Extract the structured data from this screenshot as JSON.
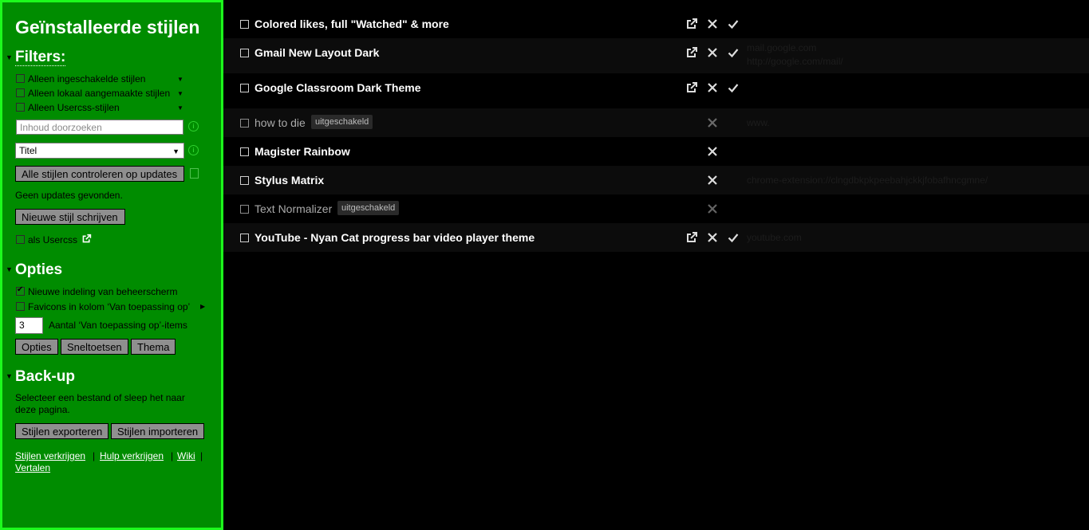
{
  "sidebar": {
    "title": "Geïnstalleerde stijlen",
    "filters": {
      "heading": "Filters:",
      "items": [
        {
          "label": "Alleen ingeschakelde stijlen",
          "checked": false
        },
        {
          "label": "Alleen lokaal aangemaakte stijlen",
          "checked": false
        },
        {
          "label": "Alleen Usercss-stijlen",
          "checked": false
        }
      ],
      "search_placeholder": "Inhoud doorzoeken",
      "sort_value": "Titel"
    },
    "check_updates_label": "Alle stijlen controleren op updates",
    "update_status": "Geen updates gevonden.",
    "new_style_label": "Nieuwe stijl schrijven",
    "as_usercss_label": "als Usercss",
    "options": {
      "heading": "Opties",
      "new_layout_label": "Nieuwe indeling van beheerscherm",
      "new_layout_checked": true,
      "favicons_label": "Favicons in kolom ‘Van toepassing op’",
      "favicons_checked": false,
      "applies_count_value": "3",
      "applies_count_label": "Aantal ‘Van toepassing op’-items",
      "buttons": {
        "options": "Opties",
        "shortcuts": "Sneltoetsen",
        "theme": "Thema"
      }
    },
    "backup": {
      "heading": "Back-up",
      "description_line1": "Selecteer een bestand of sleep het naar",
      "description_line2": "deze pagina.",
      "export_label": "Stijlen exporteren",
      "import_label": "Stijlen importeren"
    },
    "links": {
      "get_styles": "Stijlen verkrijgen",
      "get_help": "Hulp verkrijgen",
      "wiki": "Wiki",
      "translate": "Vertalen",
      "separator": "|"
    }
  },
  "styles": [
    {
      "name": "Colored likes, full \"Watched\" & more",
      "enabled": true,
      "external": true,
      "badge": "",
      "applies": []
    },
    {
      "name": "Gmail New Layout Dark",
      "enabled": true,
      "external": true,
      "badge": "",
      "applies": [
        "mail.google.com",
        "http://google.com/mail/"
      ]
    },
    {
      "name": "Google Classroom Dark Theme",
      "enabled": true,
      "external": true,
      "badge": "",
      "applies": []
    },
    {
      "name": "how to die",
      "enabled": false,
      "external": false,
      "badge": "uitgeschakeld",
      "applies": [
        "www."
      ]
    },
    {
      "name": "Magister Rainbow",
      "enabled": true,
      "external": false,
      "badge": "",
      "applies": []
    },
    {
      "name": "Stylus Matrix",
      "enabled": true,
      "external": false,
      "badge": "",
      "applies": [
        "chrome-extension://clngdbkpkpeebahjckkjfobafhncgmne/"
      ]
    },
    {
      "name": "Text Normalizer",
      "enabled": false,
      "external": false,
      "badge": "uitgeschakeld",
      "applies": []
    },
    {
      "name": "YouTube - Nyan Cat progress bar video player theme",
      "enabled": true,
      "external": true,
      "badge": "",
      "applies": [
        "youtube.com"
      ]
    }
  ],
  "colors": {
    "sidebar_bg": "#008c00",
    "sidebar_border": "#1cfa1c",
    "main_bg": "#000000"
  },
  "icons": {
    "external": "external-link-icon",
    "delete": "close-icon",
    "check": "check-icon",
    "info": "info-icon",
    "dropdown": "chevron-down-icon",
    "update": "update-icon"
  }
}
